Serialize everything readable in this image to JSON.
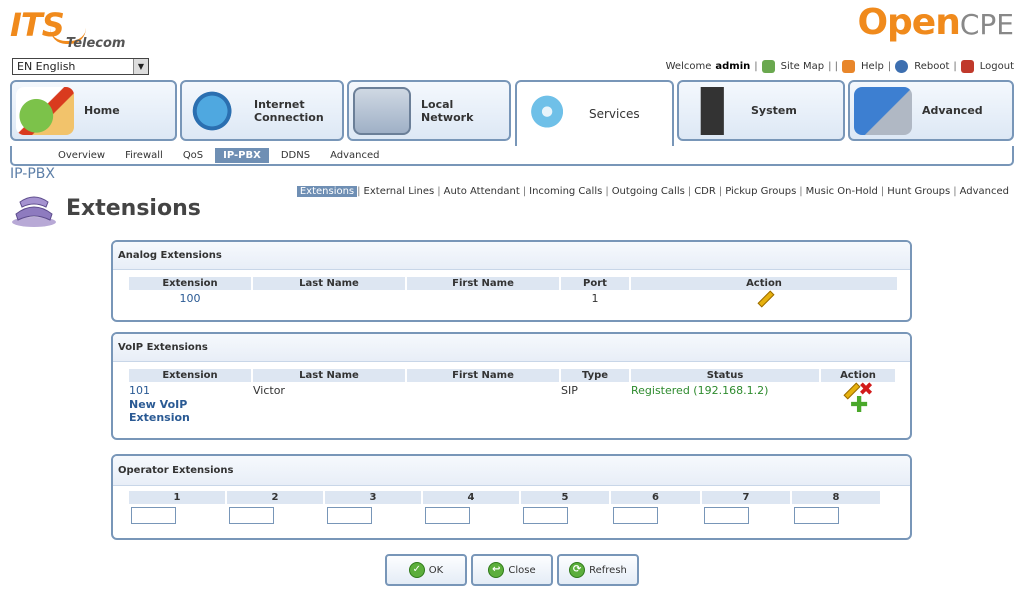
{
  "brand": {
    "its": "ITS",
    "telecom": "Telecom",
    "ocpe_open": "Open",
    "ocpe_cpe": "CPE"
  },
  "language": {
    "selected": "EN English"
  },
  "toplinks": {
    "welcome": "Welcome",
    "user": "admin",
    "sitemap": "Site Map",
    "help": "Help",
    "reboot": "Reboot",
    "logout": "Logout"
  },
  "nav": [
    {
      "line1": "Home",
      "line2": ""
    },
    {
      "line1": "Internet",
      "line2": "Connection"
    },
    {
      "line1": "Local",
      "line2": "Network"
    },
    {
      "line1": "Services",
      "line2": ""
    },
    {
      "line1": "System",
      "line2": ""
    },
    {
      "line1": "Advanced",
      "line2": ""
    }
  ],
  "subnav": [
    "Overview",
    "Firewall",
    "QoS",
    "IP-PBX",
    "DDNS",
    "Advanced"
  ],
  "breadcrumb": "IP-PBX",
  "pagenav": [
    "Extensions",
    "External Lines",
    "Auto Attendant",
    "Incoming Calls",
    "Outgoing Calls",
    "CDR",
    "Pickup Groups",
    "Music On-Hold",
    "Hunt Groups",
    "Advanced"
  ],
  "page_title": "Extensions",
  "analog": {
    "title": "Analog Extensions",
    "headers": [
      "Extension",
      "Last Name",
      "First Name",
      "Port",
      "Action"
    ],
    "rows": [
      {
        "extension": "100",
        "last": "",
        "first": "",
        "port": "1"
      }
    ]
  },
  "voip": {
    "title": "VoIP Extensions",
    "headers": [
      "Extension",
      "Last Name",
      "First Name",
      "Type",
      "Status",
      "Action"
    ],
    "rows": [
      {
        "extension": "101",
        "last": "Victor",
        "first": "",
        "type": "SIP",
        "status": "Registered (192.168.1.2)"
      }
    ],
    "new_line1": "New VoIP",
    "new_line2": "Extension"
  },
  "operator": {
    "title": "Operator Extensions",
    "headers": [
      "1",
      "2",
      "3",
      "4",
      "5",
      "6",
      "7",
      "8"
    ],
    "values": [
      "",
      "",
      "",
      "",
      "",
      "",
      "",
      ""
    ]
  },
  "buttons": {
    "ok": "OK",
    "close": "Close",
    "refresh": "Refresh"
  },
  "colors": {
    "accent": "#f08a1c",
    "border": "#7896b8",
    "link": "#2a5a94",
    "status_ok": "#2e8b2e"
  }
}
